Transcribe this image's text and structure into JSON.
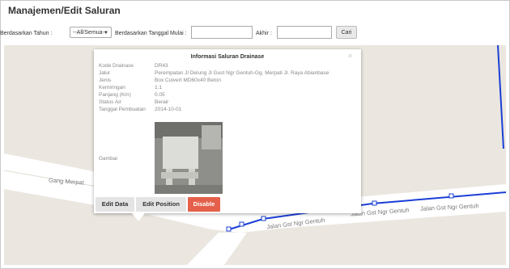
{
  "page": {
    "title": "Manajemen/Edit Saluran"
  },
  "filter": {
    "tahun_label": "Berdasarkan Tahun :",
    "tahun_value": "--All/Semua--",
    "tanggal_label": "Berdasarkan Tanggal Mulai :",
    "tanggal_mulai_value": "",
    "akhir_label": "Akhir :",
    "akhir_value": "",
    "cari_label": "Cari"
  },
  "map": {
    "street_labels": [
      "Gang Merpat",
      "Jalan Gst Ngr Gentuh",
      "Jalan Gst Ngr Gentuh",
      "Jalan Gst Ngr Gentuh"
    ],
    "line_color": "#1a3fd6"
  },
  "popup": {
    "title": "Informasi Saluran Drainase",
    "fields": [
      {
        "label": "Kode Drainase",
        "value": "DR43"
      },
      {
        "label": "Jalur",
        "value": "Perempatan Jl Delung Jl Gust Ngr Gentuh-Gg. Merpati Jl. Raya Abianbase"
      },
      {
        "label": "Jenis",
        "value": "Box Culvert MD60x40 Beton"
      },
      {
        "label": "Kemiringan",
        "value": "1:1"
      },
      {
        "label": "Panjang (Km)",
        "value": "0.05"
      },
      {
        "label": "Status Air",
        "value": "Berair"
      },
      {
        "label": "Tanggal Pembuatan",
        "value": "2014-10-01"
      }
    ],
    "gambar_label": "Gambar",
    "buttons": {
      "edit_data": "Edit Data",
      "edit_position": "Edit Position",
      "disable": "Disable"
    }
  }
}
